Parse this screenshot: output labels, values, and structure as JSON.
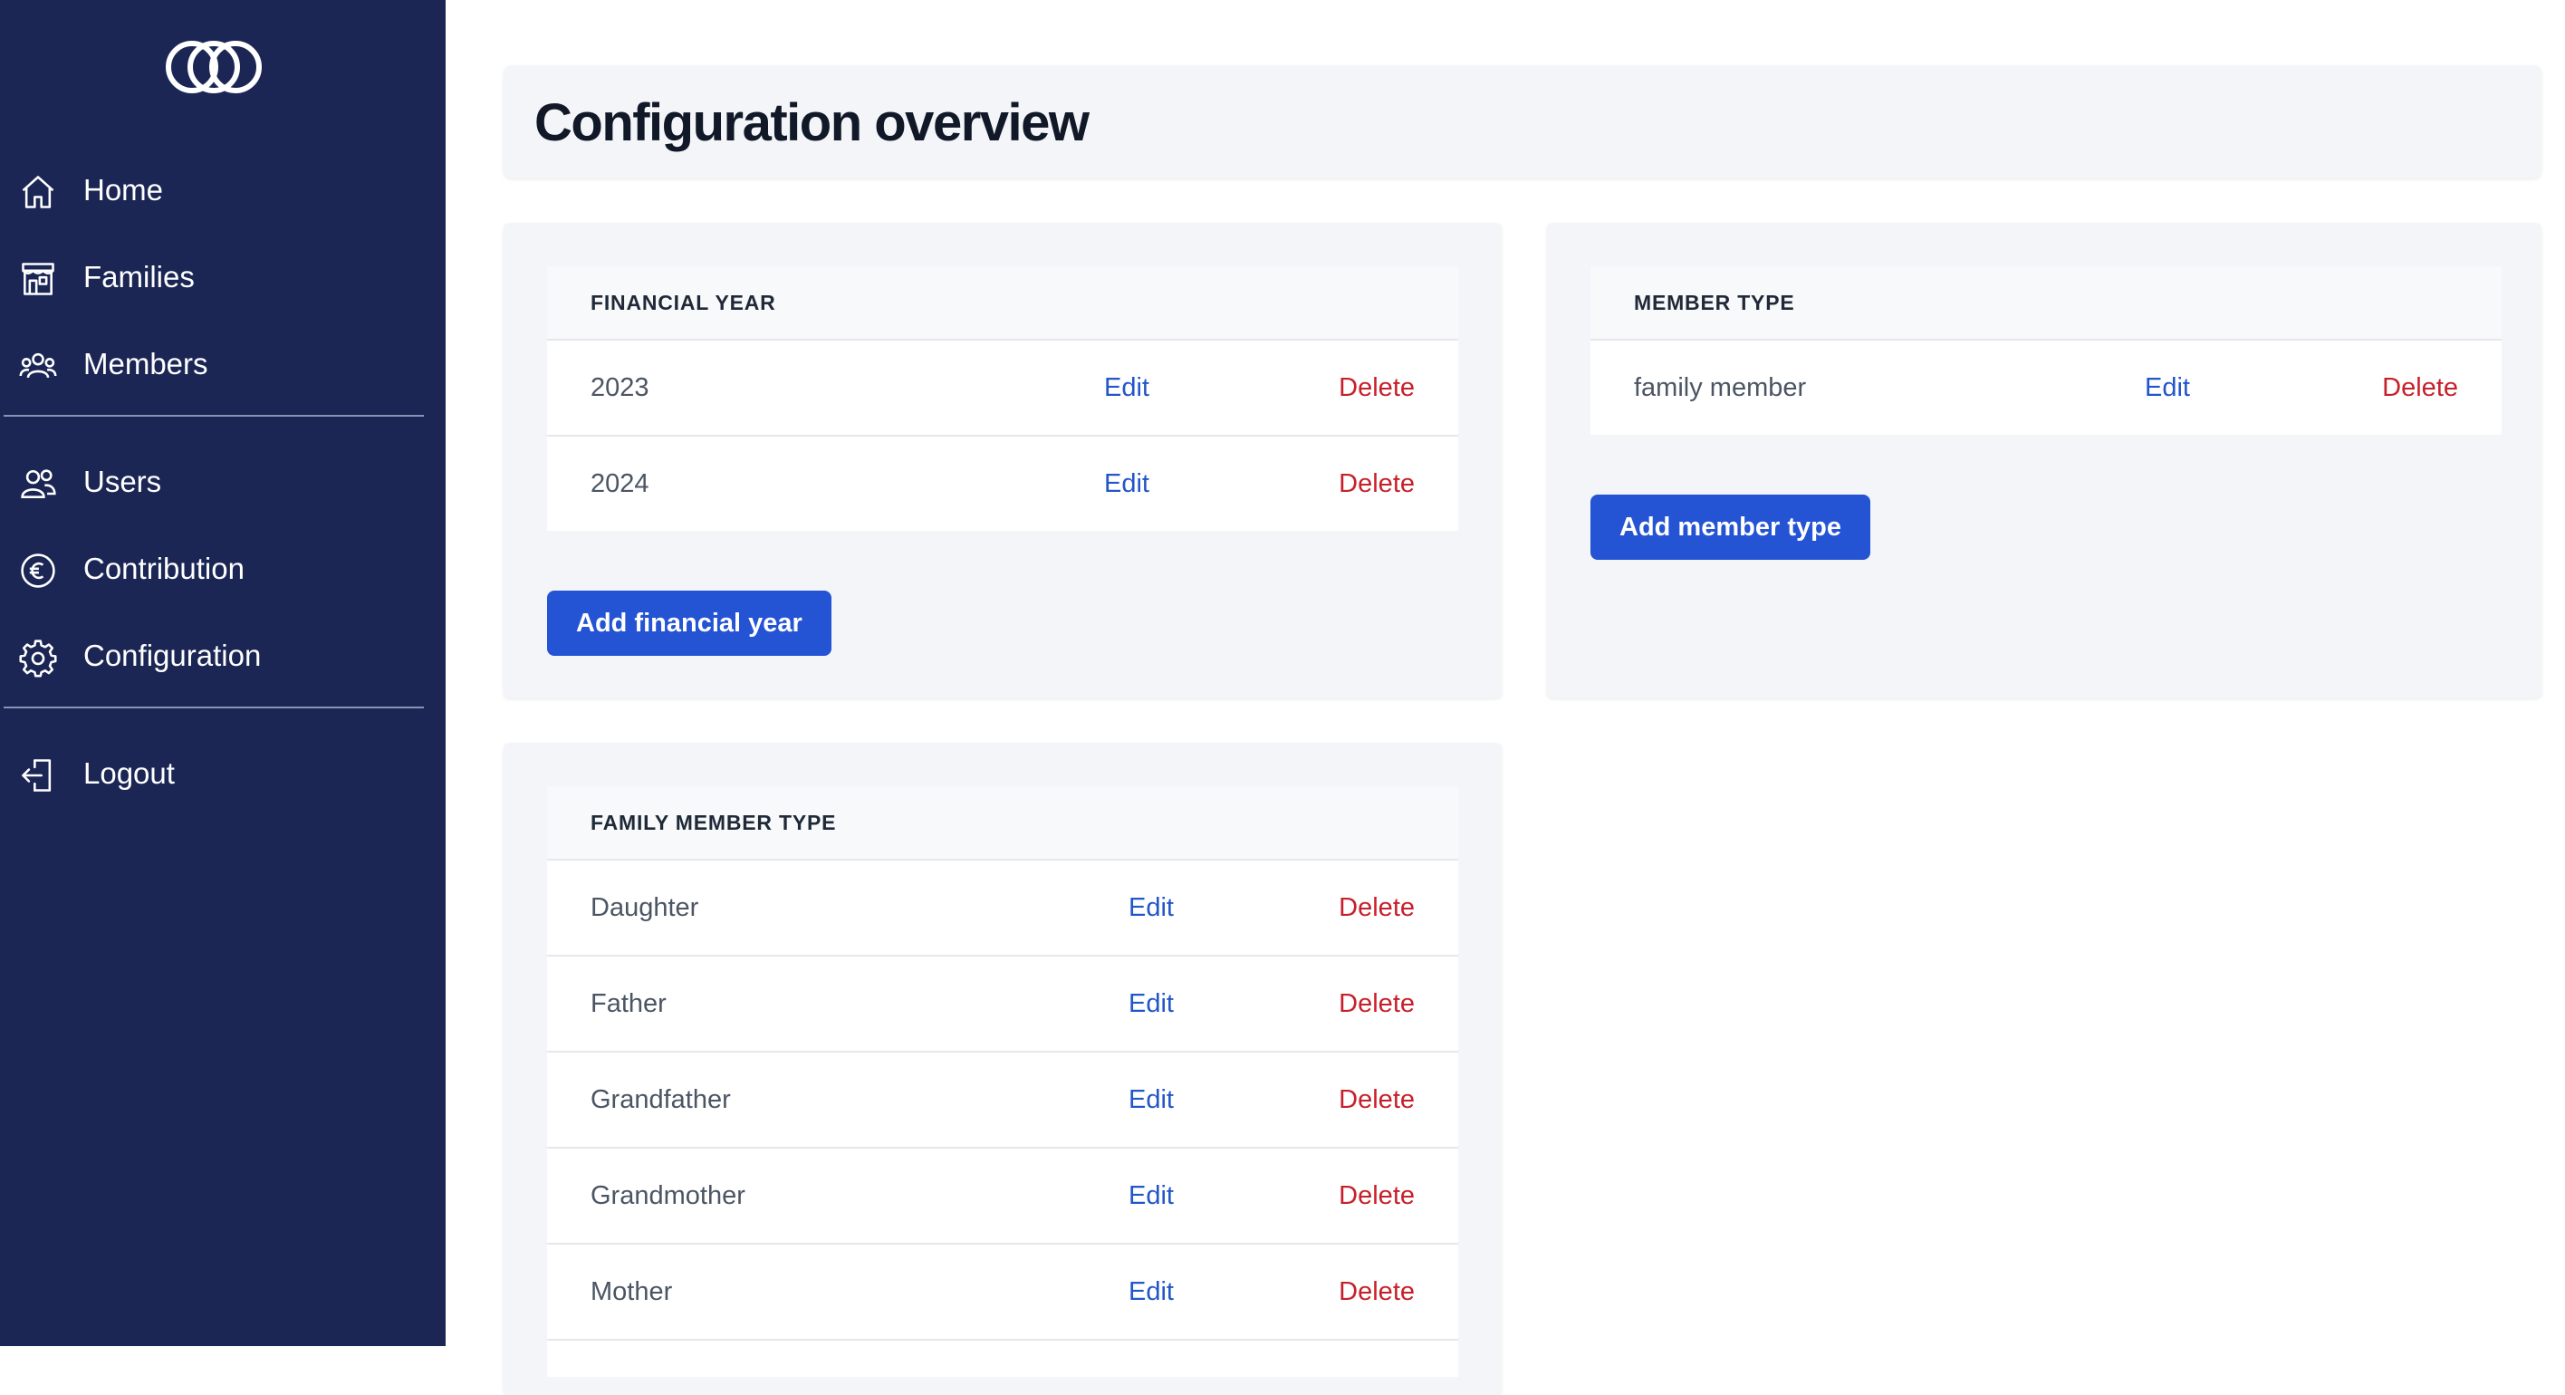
{
  "sidebar": {
    "logo_icon": "interlocking-rings-logo",
    "items": [
      {
        "label": "Home",
        "icon": "home-icon"
      },
      {
        "label": "Families",
        "icon": "building-icon"
      },
      {
        "label": "Members",
        "icon": "members-icon"
      },
      {
        "label": "Users",
        "icon": "users-icon"
      },
      {
        "label": "Contribution",
        "icon": "euro-icon"
      },
      {
        "label": "Configuration",
        "icon": "gear-icon"
      },
      {
        "label": "Logout",
        "icon": "logout-icon"
      }
    ]
  },
  "page": {
    "title": "Configuration overview"
  },
  "financial_year": {
    "header": "FINANCIAL YEAR",
    "rows": [
      {
        "name": "2023",
        "edit": "Edit",
        "delete": "Delete"
      },
      {
        "name": "2024",
        "edit": "Edit",
        "delete": "Delete"
      }
    ],
    "add_button": "Add financial year"
  },
  "member_type": {
    "header": "MEMBER TYPE",
    "rows": [
      {
        "name": "family member",
        "edit": "Edit",
        "delete": "Delete"
      }
    ],
    "add_button": "Add member type"
  },
  "family_member_type": {
    "header": "FAMILY MEMBER TYPE",
    "rows": [
      {
        "name": "Daughter",
        "edit": "Edit",
        "delete": "Delete"
      },
      {
        "name": "Father",
        "edit": "Edit",
        "delete": "Delete"
      },
      {
        "name": "Grandfather",
        "edit": "Edit",
        "delete": "Delete"
      },
      {
        "name": "Grandmother",
        "edit": "Edit",
        "delete": "Delete"
      },
      {
        "name": "Mother",
        "edit": "Edit",
        "delete": "Delete"
      }
    ]
  },
  "colors": {
    "sidebar_bg": "#1b2655",
    "primary_button": "#2453d4",
    "edit_link": "#2256c9",
    "delete_link": "#c8202a"
  }
}
